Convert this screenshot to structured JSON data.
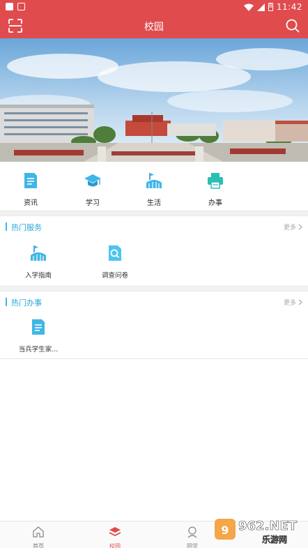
{
  "statusbar": {
    "time": "11:42",
    "battery": "8"
  },
  "header": {
    "title": "校园",
    "scan_icon": "scan-icon",
    "search_icon": "search-icon"
  },
  "quick_nav": [
    {
      "label": "资讯",
      "icon": "news-doc-icon",
      "color": "#3fb6e6"
    },
    {
      "label": "学习",
      "icon": "graduation-cap-icon",
      "color": "#3fb6e6"
    },
    {
      "label": "生活",
      "icon": "stadium-flag-icon",
      "color": "#3fb6e6"
    },
    {
      "label": "办事",
      "icon": "printer-icon",
      "color": "#2bbfb3"
    }
  ],
  "hot_services": {
    "title": "热门服务",
    "more": "更多",
    "items": [
      {
        "label": "入学指南",
        "icon": "stadium-flag-icon"
      },
      {
        "label": "调查问卷",
        "icon": "search-document-icon"
      }
    ]
  },
  "hot_affairs": {
    "title": "热门办事",
    "more": "更多",
    "items": [
      {
        "label": "当兵学生家...",
        "icon": "document-icon"
      }
    ]
  },
  "tabs": [
    {
      "label": "首页",
      "icon": "home-icon",
      "active": false
    },
    {
      "label": "校园",
      "icon": "layers-icon",
      "active": true
    },
    {
      "label": "同学",
      "icon": "classmates-icon",
      "active": false
    }
  ],
  "watermark": {
    "text": "962.NET",
    "subtext": "乐游网"
  },
  "colors": {
    "brand_red": "#e04b4e",
    "accent_blue": "#3fb6e6",
    "accent_teal": "#2bbfb3"
  }
}
